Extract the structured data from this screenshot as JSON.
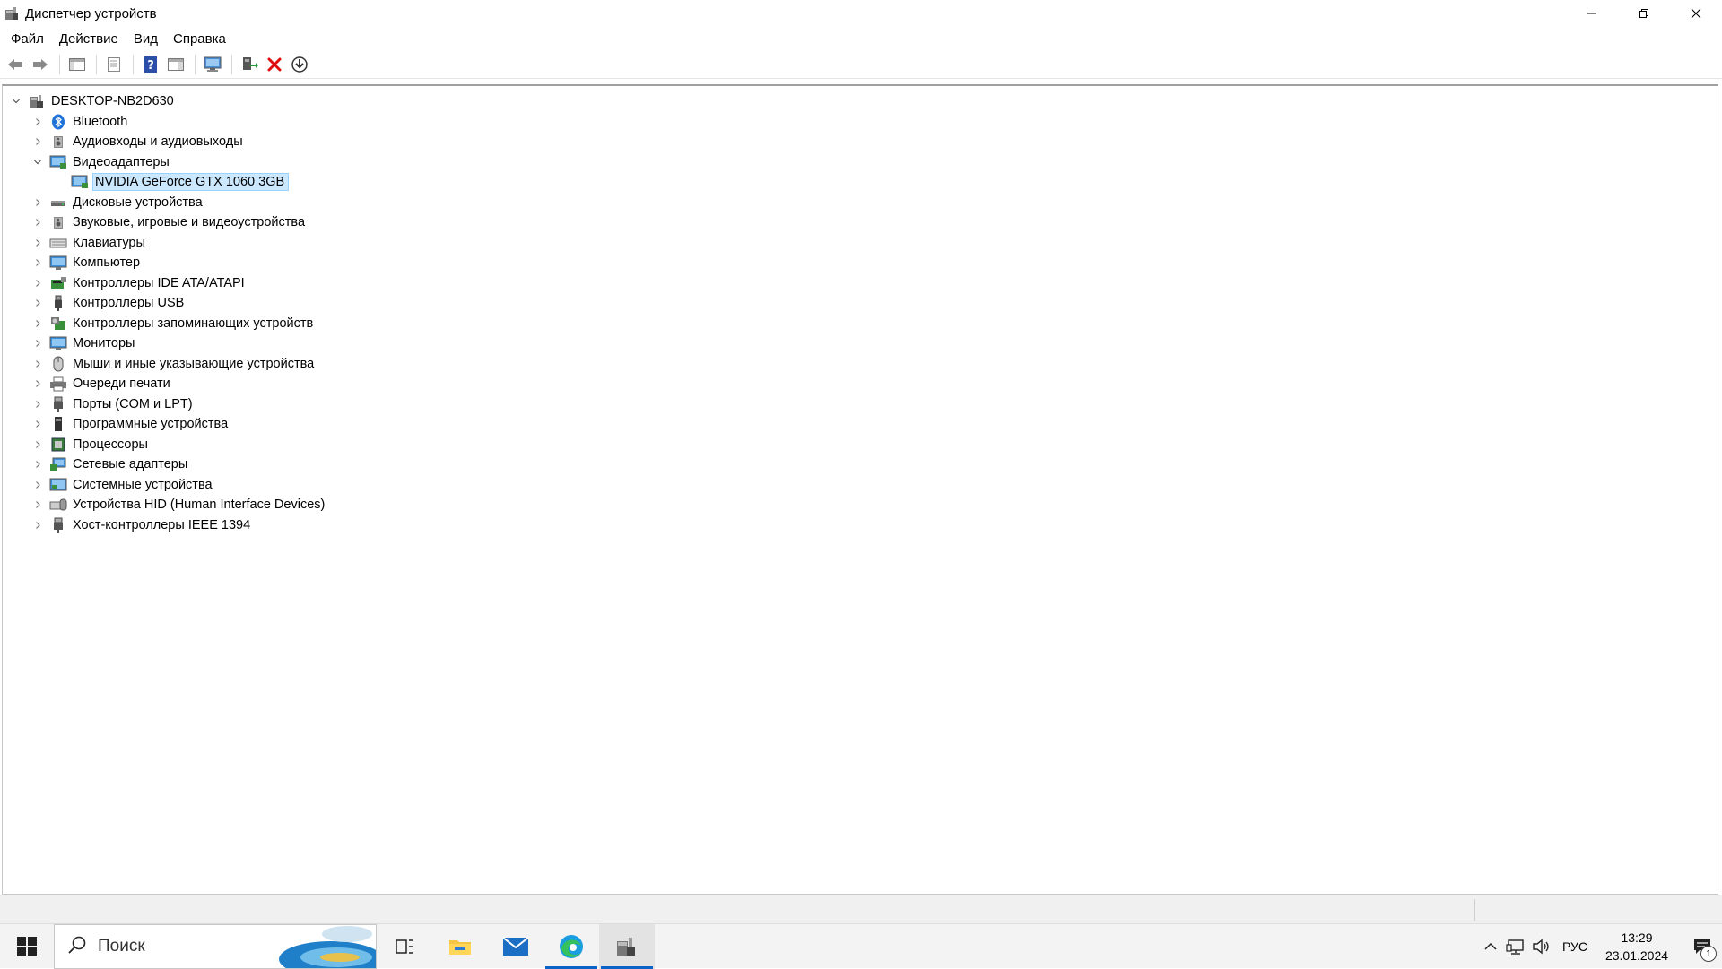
{
  "window": {
    "title": "Диспетчер устройств"
  },
  "menu": {
    "items": [
      "Файл",
      "Действие",
      "Вид",
      "Справка"
    ]
  },
  "toolbar": {
    "icons": [
      "arrow-left-icon",
      "arrow-right-icon",
      "window-pane-icon",
      "properties-sheet-icon",
      "help-icon",
      "window-pane-icon",
      "monitor-icon",
      "update-driver-icon",
      "delete-x-icon",
      "download-arrow-icon"
    ]
  },
  "tree": {
    "root": "DESKTOP-NB2D630",
    "categories": [
      {
        "label": "Bluetooth",
        "expanded": false,
        "icon": "bluetooth-icon"
      },
      {
        "label": "Аудиовходы и аудиовыходы",
        "expanded": false,
        "icon": "speaker-icon"
      },
      {
        "label": "Видеоадаптеры",
        "expanded": true,
        "icon": "display-adapter-icon",
        "children": [
          {
            "label": "NVIDIA GeForce GTX 1060 3GB",
            "selected": true
          }
        ]
      },
      {
        "label": "Дисковые устройства",
        "expanded": false,
        "icon": "disk-drive-icon"
      },
      {
        "label": "Звуковые, игровые и видеоустройства",
        "expanded": false,
        "icon": "speaker-icon"
      },
      {
        "label": "Клавиатуры",
        "expanded": false,
        "icon": "keyboard-icon"
      },
      {
        "label": "Компьютер",
        "expanded": false,
        "icon": "monitor-icon"
      },
      {
        "label": "Контроллеры IDE ATA/ATAPI",
        "expanded": false,
        "icon": "ide-controller-icon"
      },
      {
        "label": "Контроллеры USB",
        "expanded": false,
        "icon": "usb-icon"
      },
      {
        "label": "Контроллеры запоминающих устройств",
        "expanded": false,
        "icon": "storage-controller-icon"
      },
      {
        "label": "Мониторы",
        "expanded": false,
        "icon": "monitor-icon"
      },
      {
        "label": "Мыши и иные указывающие устройства",
        "expanded": false,
        "icon": "mouse-icon"
      },
      {
        "label": "Очереди печати",
        "expanded": false,
        "icon": "printer-icon"
      },
      {
        "label": "Порты (COM и LPT)",
        "expanded": false,
        "icon": "port-icon"
      },
      {
        "label": "Программные устройства",
        "expanded": false,
        "icon": "software-device-icon"
      },
      {
        "label": "Процессоры",
        "expanded": false,
        "icon": "processor-icon"
      },
      {
        "label": "Сетевые адаптеры",
        "expanded": false,
        "icon": "network-adapter-icon"
      },
      {
        "label": "Системные устройства",
        "expanded": false,
        "icon": "system-device-icon"
      },
      {
        "label": "Устройства HID (Human Interface Devices)",
        "expanded": false,
        "icon": "hid-icon"
      },
      {
        "label": "Хост-контроллеры IEEE 1394",
        "expanded": false,
        "icon": "port-icon"
      }
    ]
  },
  "taskbar": {
    "search_placeholder": "Поиск",
    "language": "РУС",
    "time": "13:29",
    "date": "23.01.2024",
    "notification_count": "1"
  },
  "colors": {
    "selection_bg": "#cce8ff",
    "selection_border": "#99d1ff",
    "accent": "#0a64c8"
  }
}
